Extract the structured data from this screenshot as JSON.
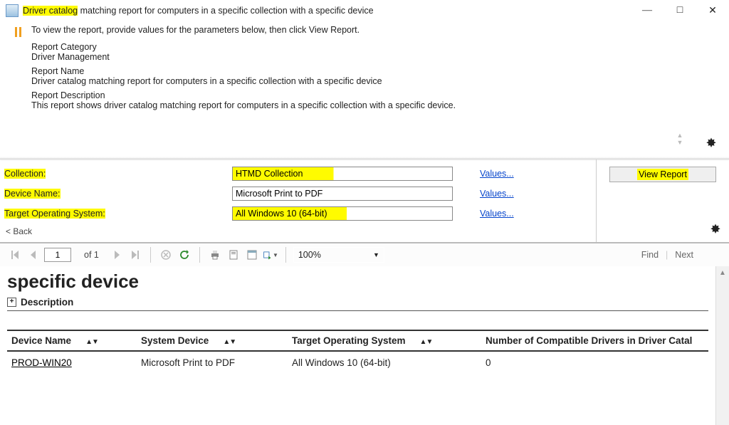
{
  "title": {
    "highlight": "Driver catalog",
    "rest": " matching report for computers in a specific collection with a specific device"
  },
  "hint": "To view the report, provide values for the parameters below, then click View Report.",
  "meta": {
    "cat_label": "Report Category",
    "cat_value": "Driver Management",
    "name_label": "Report Name",
    "name_value": "Driver catalog matching report for computers in a specific collection with a specific device",
    "desc_label": "Report Description",
    "desc_value": "This report shows driver catalog matching report for computers in a specific collection with a specific device."
  },
  "params": {
    "collection": {
      "label": "Collection:",
      "value": "HTMD Collection",
      "link": "Values..."
    },
    "device": {
      "label": "Device Name:",
      "value": "Microsoft Print to PDF",
      "link": "Values..."
    },
    "target": {
      "label": "Target Operating System:",
      "value": "All Windows 10 (64-bit)",
      "link": "Values..."
    },
    "back": "< Back"
  },
  "buttons": {
    "view_report": "View Report"
  },
  "toolbar": {
    "page_current": "1",
    "page_of": "of  1",
    "zoom": "100%",
    "find": "Find",
    "next": "Next"
  },
  "report": {
    "heading": "specific device",
    "description_label": "Description",
    "columns": {
      "c1": "Device Name",
      "c2": "System Device",
      "c3": "Target Operating System",
      "c4": "Number of Compatible Drivers in Driver Catal"
    },
    "row": {
      "device_name": "PROD-WIN20",
      "system_device": "Microsoft Print to PDF",
      "target_os": "All Windows 10 (64-bit)",
      "count": "0"
    }
  }
}
